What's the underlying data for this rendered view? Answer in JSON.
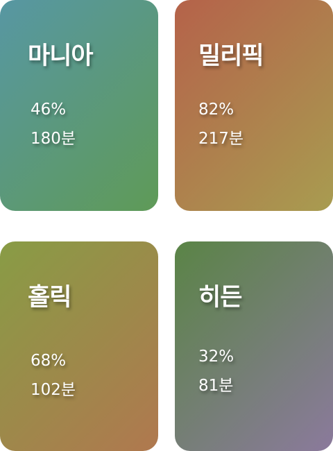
{
  "cards": [
    {
      "title": "마니아",
      "percent": "46%",
      "minutes": "180분",
      "gradient": [
        "#5797a3",
        "#5f9a57"
      ]
    },
    {
      "title": "밀리픽",
      "percent": "82%",
      "minutes": "217분",
      "gradient": [
        "#b5624a",
        "#a89c50"
      ]
    },
    {
      "title": "홀릭",
      "percent": "68%",
      "minutes": "102분",
      "gradient": [
        "#889c45",
        "#b0784f"
      ]
    },
    {
      "title": "히든",
      "percent": "32%",
      "minutes": "81분",
      "gradient": [
        "#5a8446",
        "#8b7a9c"
      ]
    }
  ]
}
